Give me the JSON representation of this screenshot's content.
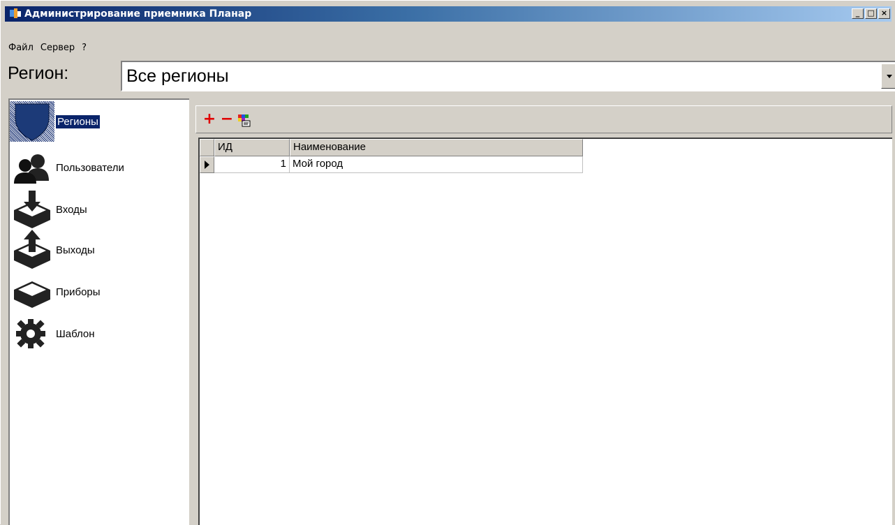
{
  "window": {
    "title": "Администрирование приемника Планар",
    "controls": {
      "minimize": "_",
      "maximize": "□",
      "close": "×"
    }
  },
  "menu": [
    "Файл",
    "Сервер",
    "?"
  ],
  "region": {
    "label": "Регион:",
    "value": "Все регионы"
  },
  "sidebar": {
    "items": [
      {
        "label": "Регионы",
        "icon": "shield-icon",
        "selected": true
      },
      {
        "label": "Пользователи",
        "icon": "users-icon"
      },
      {
        "label": "Входы",
        "icon": "box-in-icon"
      },
      {
        "label": "Выходы",
        "icon": "box-out-icon"
      },
      {
        "label": "Приборы",
        "icon": "box-icon"
      },
      {
        "label": "Шаблон",
        "icon": "gear-icon"
      }
    ]
  },
  "toolbar": {
    "add_symbol": "+",
    "remove_symbol": "−",
    "colors": {
      "add": "#e00000",
      "remove": "#e00000"
    }
  },
  "grid": {
    "columns": [
      "ИД",
      "Наименование"
    ],
    "rows": [
      {
        "id": "1",
        "name": "Мой город"
      }
    ]
  }
}
